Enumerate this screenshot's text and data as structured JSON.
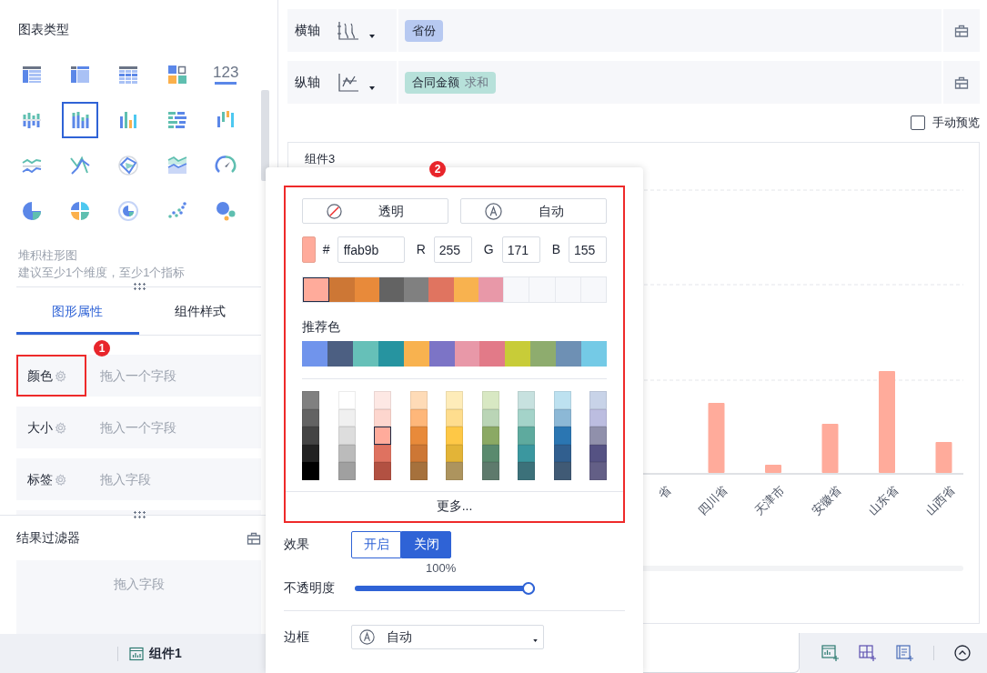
{
  "left_panel": {
    "title": "图表类型",
    "chart_types": [
      {
        "kind": "table",
        "selected": false
      },
      {
        "kind": "pivot",
        "selected": false
      },
      {
        "kind": "grid",
        "selected": false
      },
      {
        "kind": "tiles",
        "selected": false
      },
      {
        "kind": "number",
        "label": "123",
        "selected": false
      },
      {
        "kind": "grouped",
        "selected": false
      },
      {
        "kind": "stacked",
        "selected": true
      },
      {
        "kind": "bars",
        "selected": false
      },
      {
        "kind": "hbars",
        "selected": false
      },
      {
        "kind": "range",
        "selected": false
      },
      {
        "kind": "lines",
        "selected": false
      },
      {
        "kind": "cross",
        "selected": false
      },
      {
        "kind": "radar",
        "selected": false
      },
      {
        "kind": "area",
        "selected": false
      },
      {
        "kind": "gauge",
        "selected": false
      },
      {
        "kind": "pie",
        "selected": false
      },
      {
        "kind": "quadrant",
        "selected": false
      },
      {
        "kind": "ring",
        "selected": false
      },
      {
        "kind": "scatter",
        "selected": false
      },
      {
        "kind": "bubble",
        "selected": false
      }
    ],
    "chart_name": "堆积柱形图",
    "chart_hint": "建议至少1个维度，至少1个指标",
    "tabs": [
      {
        "label": "图形属性",
        "selected": true
      },
      {
        "label": "组件样式",
        "selected": false
      }
    ],
    "fields": [
      {
        "label": "颜色",
        "hint": "拖入一个字段",
        "highlighted": true,
        "badge": "1"
      },
      {
        "label": "大小",
        "hint": "拖入一个字段",
        "highlighted": false
      },
      {
        "label": "标签",
        "hint": "拖入字段",
        "highlighted": false
      }
    ],
    "filter": {
      "title": "结果过滤器",
      "hint": "拖入字段"
    },
    "component_tab": "组件1"
  },
  "axes": [
    {
      "label": "横轴",
      "pills": [
        {
          "kind": "dimension",
          "name": "省份"
        }
      ]
    },
    {
      "label": "纵轴",
      "pills": [
        {
          "kind": "measure",
          "name": "合同金额",
          "aggregation": "求和"
        }
      ]
    }
  ],
  "manual_preview": {
    "label": "手动预览",
    "checked": false
  },
  "chart": {
    "title": "组件3",
    "x_labels": [
      "省",
      "四川省",
      "天津市",
      "安徽省",
      "山东省",
      "山西省"
    ]
  },
  "popup": {
    "badge": "2",
    "buttons": [
      {
        "kind": "transparent",
        "label": "透明"
      },
      {
        "kind": "auto",
        "label": "自动"
      }
    ],
    "hex_label": "#",
    "hex": "ffab9b",
    "channels": [
      {
        "label": "R",
        "value": "255"
      },
      {
        "label": "G",
        "value": "171"
      },
      {
        "label": "B",
        "value": "155"
      }
    ],
    "recent": [
      {
        "kind": "color",
        "color": "#ffab9b",
        "selected": true
      },
      {
        "kind": "color",
        "color": "#cd7735",
        "selected": false
      },
      {
        "kind": "color",
        "color": "#e88a3a",
        "selected": false
      },
      {
        "kind": "color",
        "color": "#636363",
        "selected": false
      },
      {
        "kind": "color",
        "color": "#808080",
        "selected": false
      },
      {
        "kind": "color",
        "color": "#e07460",
        "selected": false
      },
      {
        "kind": "color",
        "color": "#f8b24f",
        "selected": false
      },
      {
        "kind": "color",
        "color": "#e898a8",
        "selected": false
      },
      {
        "kind": "empty"
      },
      {
        "kind": "empty"
      },
      {
        "kind": "empty"
      },
      {
        "kind": "empty"
      }
    ],
    "recommended_title": "推荐色",
    "recommended": [
      {
        "color": "#7094ec"
      },
      {
        "color": "#4c5f82"
      },
      {
        "color": "#66c0b8"
      },
      {
        "color": "#2694a0"
      },
      {
        "color": "#f8b24f"
      },
      {
        "color": "#7c74c6"
      },
      {
        "color": "#e898a8"
      },
      {
        "color": "#e27a88"
      },
      {
        "color": "#c8cc38"
      },
      {
        "color": "#8eac6e"
      },
      {
        "color": "#6e90b4"
      },
      {
        "color": "#74cae6"
      }
    ],
    "palette": [
      {
        "swatches": [
          {
            "color": "#808080",
            "selected": false
          },
          {
            "color": "#636363",
            "selected": false
          },
          {
            "color": "#444444",
            "selected": false
          },
          {
            "color": "#222222",
            "selected": false
          },
          {
            "color": "#000000",
            "selected": false
          }
        ]
      },
      {
        "swatches": [
          {
            "color": "#ffffff",
            "selected": false
          },
          {
            "color": "#f0f0f0",
            "selected": false
          },
          {
            "color": "#dddddd",
            "selected": false
          },
          {
            "color": "#bbbbbb",
            "selected": false
          },
          {
            "color": "#a0a0a0",
            "selected": false
          }
        ]
      },
      {
        "swatches": [
          {
            "color": "#fde8e4",
            "selected": false
          },
          {
            "color": "#fdd6ce",
            "selected": false
          },
          {
            "color": "#ffab9b",
            "selected": true
          },
          {
            "color": "#df7260",
            "selected": false
          },
          {
            "color": "#b25142",
            "selected": false
          }
        ]
      },
      {
        "swatches": [
          {
            "color": "#fedbb7",
            "selected": false
          },
          {
            "color": "#feb77a",
            "selected": false
          },
          {
            "color": "#e88a3a",
            "selected": false
          },
          {
            "color": "#cd7735",
            "selected": false
          },
          {
            "color": "#a6713c",
            "selected": false
          }
        ]
      },
      {
        "swatches": [
          {
            "color": "#feecb9",
            "selected": false
          },
          {
            "color": "#fedd8e",
            "selected": false
          },
          {
            "color": "#fec846",
            "selected": false
          },
          {
            "color": "#e3b437",
            "selected": false
          },
          {
            "color": "#ad945e",
            "selected": false
          }
        ]
      },
      {
        "swatches": [
          {
            "color": "#d8e8c3",
            "selected": false
          },
          {
            "color": "#bad5b6",
            "selected": false
          },
          {
            "color": "#8ba964",
            "selected": false
          },
          {
            "color": "#5a8a6e",
            "selected": false
          },
          {
            "color": "#5e7a6c",
            "selected": false
          }
        ]
      },
      {
        "swatches": [
          {
            "color": "#c7e1df",
            "selected": false
          },
          {
            "color": "#a4d3c9",
            "selected": false
          },
          {
            "color": "#5eaa9e",
            "selected": false
          },
          {
            "color": "#3b979f",
            "selected": false
          },
          {
            "color": "#3c717a",
            "selected": false
          }
        ]
      },
      {
        "swatches": [
          {
            "color": "#bde1f0",
            "selected": false
          },
          {
            "color": "#8cb8d6",
            "selected": false
          },
          {
            "color": "#2b76b2",
            "selected": false
          },
          {
            "color": "#315f8f",
            "selected": false
          },
          {
            "color": "#405a75",
            "selected": false
          }
        ]
      },
      {
        "swatches": [
          {
            "color": "#c8d3e8",
            "selected": false
          },
          {
            "color": "#bcbde0",
            "selected": false
          },
          {
            "color": "#9090ab",
            "selected": false
          },
          {
            "color": "#555283",
            "selected": false
          },
          {
            "color": "#635f86",
            "selected": false
          }
        ]
      }
    ],
    "more": "更多...",
    "effect": {
      "label": "效果",
      "options": [
        {
          "label": "开启",
          "selected": false
        },
        {
          "label": "关闭",
          "selected": true
        }
      ]
    },
    "opacity": {
      "label": "不透明度",
      "reading": "100%",
      "level": 1
    },
    "border": {
      "label": "边框",
      "value": "自动"
    }
  }
}
